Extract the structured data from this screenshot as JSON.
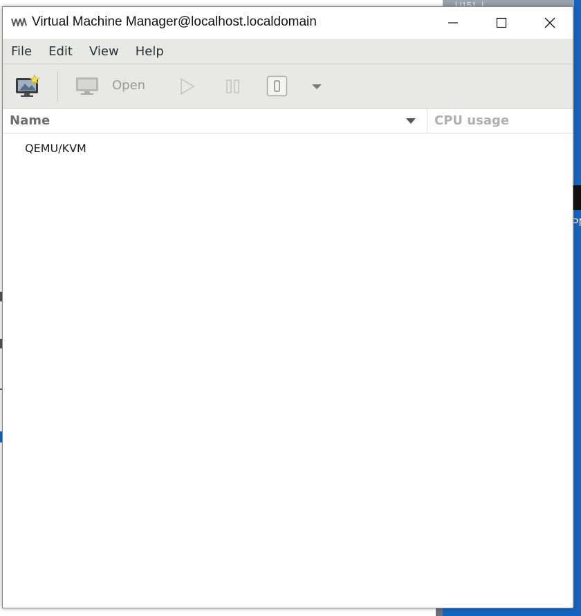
{
  "window": {
    "title": "Virtual Machine Manager@localhost.localdomain"
  },
  "menu": {
    "items": [
      "File",
      "Edit",
      "View",
      "Help"
    ]
  },
  "toolbar": {
    "open_label": "Open"
  },
  "columns": {
    "name": "Name",
    "cpu_usage": "CPU usage"
  },
  "connections": [
    {
      "label": "QEMU/KVM"
    }
  ],
  "background": {
    "top_right_text": "l.l151 .l",
    "partial_letter": "PN"
  },
  "colors": {
    "chrome": "#e8e8e7",
    "desktop_blue": "#1565c0"
  }
}
